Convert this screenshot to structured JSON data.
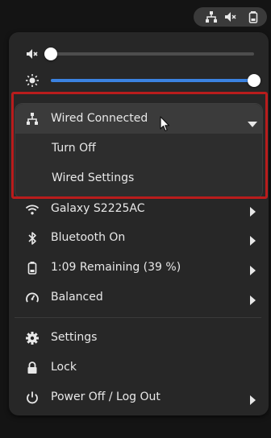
{
  "top_bar": {
    "icons": [
      "network-wired-icon",
      "audio-muted-icon",
      "battery-icon"
    ]
  },
  "sliders": {
    "volume": {
      "icon": "speaker-muted-icon",
      "level": 0.0
    },
    "brightness": {
      "icon": "sun-icon",
      "level": 1.0
    }
  },
  "network": {
    "header_label": "Wired Connected",
    "icon": "network-wired-icon",
    "expanded": true,
    "items": [
      {
        "label": "Turn Off"
      },
      {
        "label": "Wired Settings"
      }
    ]
  },
  "menu": {
    "wifi": {
      "label": "Galaxy S2225AC",
      "icon": "wifi-icon"
    },
    "bluetooth": {
      "label": "Bluetooth On",
      "icon": "bluetooth-icon"
    },
    "battery": {
      "label": "1:09 Remaining (39 %)",
      "icon": "battery-icon"
    },
    "power_mode": {
      "label": "Balanced",
      "icon": "power-mode-icon"
    },
    "settings": {
      "label": "Settings",
      "icon": "gear-icon"
    },
    "lock": {
      "label": "Lock",
      "icon": "lock-icon"
    },
    "power": {
      "label": "Power Off / Log Out",
      "icon": "power-icon"
    }
  },
  "colors": {
    "accent": "#3b82e0",
    "highlight_border": "#b91c1c",
    "menu_bg": "#272727",
    "text": "#e8e8e8"
  }
}
